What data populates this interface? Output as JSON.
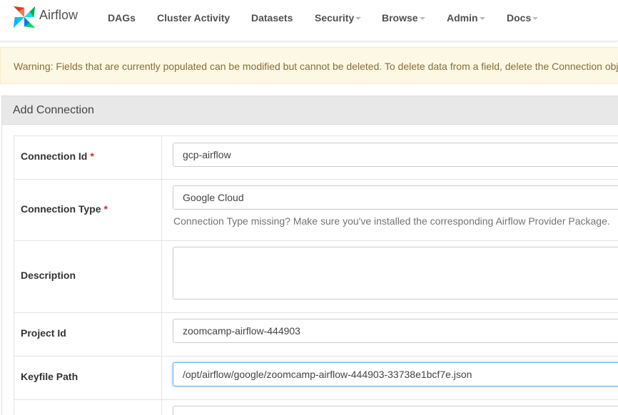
{
  "brand": {
    "name": "Airflow",
    "logo_icon": "airflow-pinwheel-icon"
  },
  "nav": {
    "items": [
      {
        "label": "DAGs",
        "dropdown": false
      },
      {
        "label": "Cluster Activity",
        "dropdown": false
      },
      {
        "label": "Datasets",
        "dropdown": false
      },
      {
        "label": "Security",
        "dropdown": true
      },
      {
        "label": "Browse",
        "dropdown": true
      },
      {
        "label": "Admin",
        "dropdown": true
      },
      {
        "label": "Docs",
        "dropdown": true
      }
    ]
  },
  "warning": {
    "text": "Warning: Fields that are currently populated can be modified but cannot be deleted. To delete data from a field, delete the Connection object"
  },
  "panel": {
    "title": "Add Connection"
  },
  "form": {
    "connection_id": {
      "label": "Connection Id",
      "required": "*",
      "value": "gcp-airflow"
    },
    "connection_type": {
      "label": "Connection Type",
      "required": "*",
      "value": "Google Cloud",
      "help": "Connection Type missing? Make sure you've installed the corresponding Airflow Provider Package."
    },
    "description": {
      "label": "Description",
      "value": ""
    },
    "project_id": {
      "label": "Project Id",
      "value": "zoomcamp-airflow-444903"
    },
    "keyfile_path": {
      "label": "Keyfile Path",
      "value": "/opt/airflow/google/zoomcamp-airflow-444903-33738e1bcf7e.json"
    }
  },
  "colors": {
    "accent": "#017cee",
    "warning_bg": "#fcf8e3",
    "warning_text": "#8a6d3b",
    "required": "#c9302c",
    "focus": "#66afe9"
  }
}
